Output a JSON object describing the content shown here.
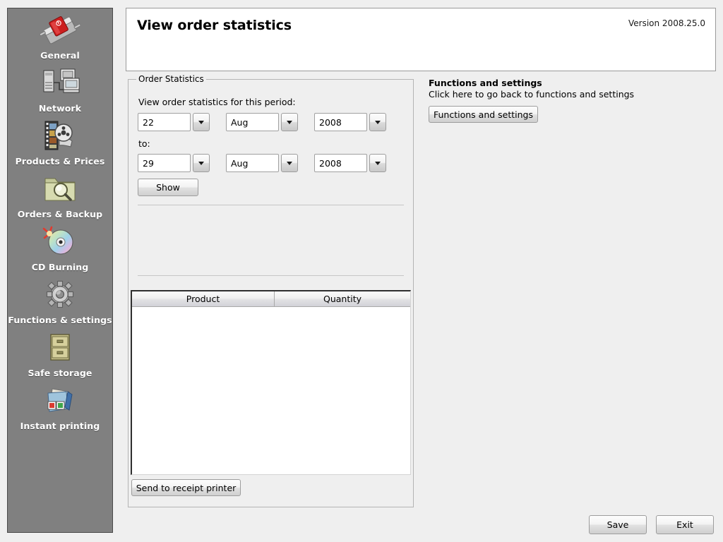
{
  "header": {
    "title": "View order statistics",
    "version": "Version 2008.25.0"
  },
  "sidebar": {
    "items": [
      {
        "label": "General",
        "icon": "power-switch-icon"
      },
      {
        "label": "Network",
        "icon": "network-computers-icon"
      },
      {
        "label": "Products & Prices",
        "icon": "filmstrip-reel-icon"
      },
      {
        "label": "Orders & Backup",
        "icon": "folder-search-icon"
      },
      {
        "label": "CD Burning",
        "icon": "cd-disc-icon"
      },
      {
        "label": "Functions & settings",
        "icon": "gear-icon"
      },
      {
        "label": "Safe storage",
        "icon": "filing-cabinet-icon"
      },
      {
        "label": "Instant printing",
        "icon": "photos-folder-icon"
      }
    ]
  },
  "order_statistics": {
    "group_title": "Order Statistics",
    "period_label": "View order statistics for this period:",
    "to_label": "to:",
    "from_date": {
      "day": "22",
      "month": "Aug",
      "year": "2008"
    },
    "to_date": {
      "day": "29",
      "month": "Aug",
      "year": "2008"
    },
    "show_button": "Show",
    "receipt_button": "Send to receipt printer",
    "table": {
      "columns": [
        "Product",
        "Quantity"
      ],
      "rows": []
    }
  },
  "right_panel": {
    "heading": "Functions and settings",
    "subtext": "Click here to go back to functions and settings",
    "button": "Functions and settings"
  },
  "footer": {
    "save": "Save",
    "exit": "Exit"
  }
}
